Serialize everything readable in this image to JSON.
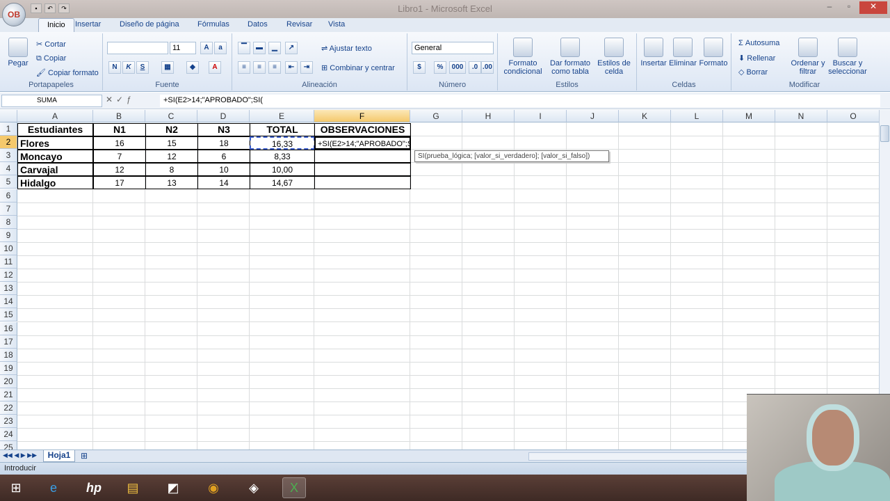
{
  "window": {
    "title": "Libro1 - Microsoft Excel",
    "office_button": "OB"
  },
  "tabs": [
    "Inicio",
    "Insertar",
    "Diseño de página",
    "Fórmulas",
    "Datos",
    "Revisar",
    "Vista"
  ],
  "ribbon": {
    "portapapeles": {
      "name": "Portapapeles",
      "paste": "Pegar",
      "cut": "Cortar",
      "copy": "Copiar",
      "format_painter": "Copiar formato"
    },
    "fuente": {
      "name": "Fuente",
      "font": "",
      "size": "11",
      "bold": "N",
      "italic": "K",
      "underline": "S"
    },
    "alineacion": {
      "name": "Alineación",
      "wrap": "Ajustar texto",
      "merge": "Combinar y centrar"
    },
    "numero": {
      "name": "Número",
      "format": "General",
      "currency": "$",
      "percent": "%",
      "thousands": "000"
    },
    "estilos": {
      "name": "Estilos",
      "cond": "Formato condicional",
      "table": "Dar formato como tabla",
      "cell": "Estilos de celda"
    },
    "celdas": {
      "name": "Celdas",
      "insert": "Insertar",
      "delete": "Eliminar",
      "format": "Formato"
    },
    "modificar": {
      "name": "Modificar",
      "autosum": "Autosuma",
      "fill": "Rellenar",
      "clear": "Borrar",
      "sort": "Ordenar y filtrar",
      "find": "Buscar y seleccionar"
    }
  },
  "formula_bar": {
    "name_box": "SUMA",
    "formula": "+SI(E2>14;\"APROBADO\";SI("
  },
  "columns": [
    "A",
    "B",
    "C",
    "D",
    "E",
    "F",
    "G",
    "H",
    "I",
    "J",
    "K",
    "L",
    "M",
    "N",
    "O"
  ],
  "rows": [
    "1",
    "2",
    "3",
    "4",
    "5",
    "6",
    "7",
    "8",
    "9",
    "10",
    "11",
    "12",
    "13",
    "14",
    "15",
    "16",
    "17",
    "18",
    "19",
    "20",
    "21",
    "22",
    "23",
    "24",
    "25"
  ],
  "table": {
    "headers": [
      "Estudiantes",
      "N1",
      "N2",
      "N3",
      "TOTAL",
      "OBSERVACIONES"
    ],
    "rows": [
      {
        "name": "Flores",
        "n1": "16",
        "n2": "15",
        "n3": "18",
        "total": "16,33",
        "obs": "+SI(E2>14;\"APROBADO\";SI("
      },
      {
        "name": "Moncayo",
        "n1": "7",
        "n2": "12",
        "n3": "6",
        "total": "8,33",
        "obs": ""
      },
      {
        "name": "Carvajal",
        "n1": "12",
        "n2": "8",
        "n3": "10",
        "total": "10,00",
        "obs": ""
      },
      {
        "name": "Hidalgo",
        "n1": "17",
        "n2": "13",
        "n3": "14",
        "total": "14,67",
        "obs": ""
      }
    ]
  },
  "tooltip": "SI(prueba_lógica; [valor_si_verdadero]; [valor_si_falso])",
  "sheet_tab": "Hoja1",
  "status": "Introducir"
}
